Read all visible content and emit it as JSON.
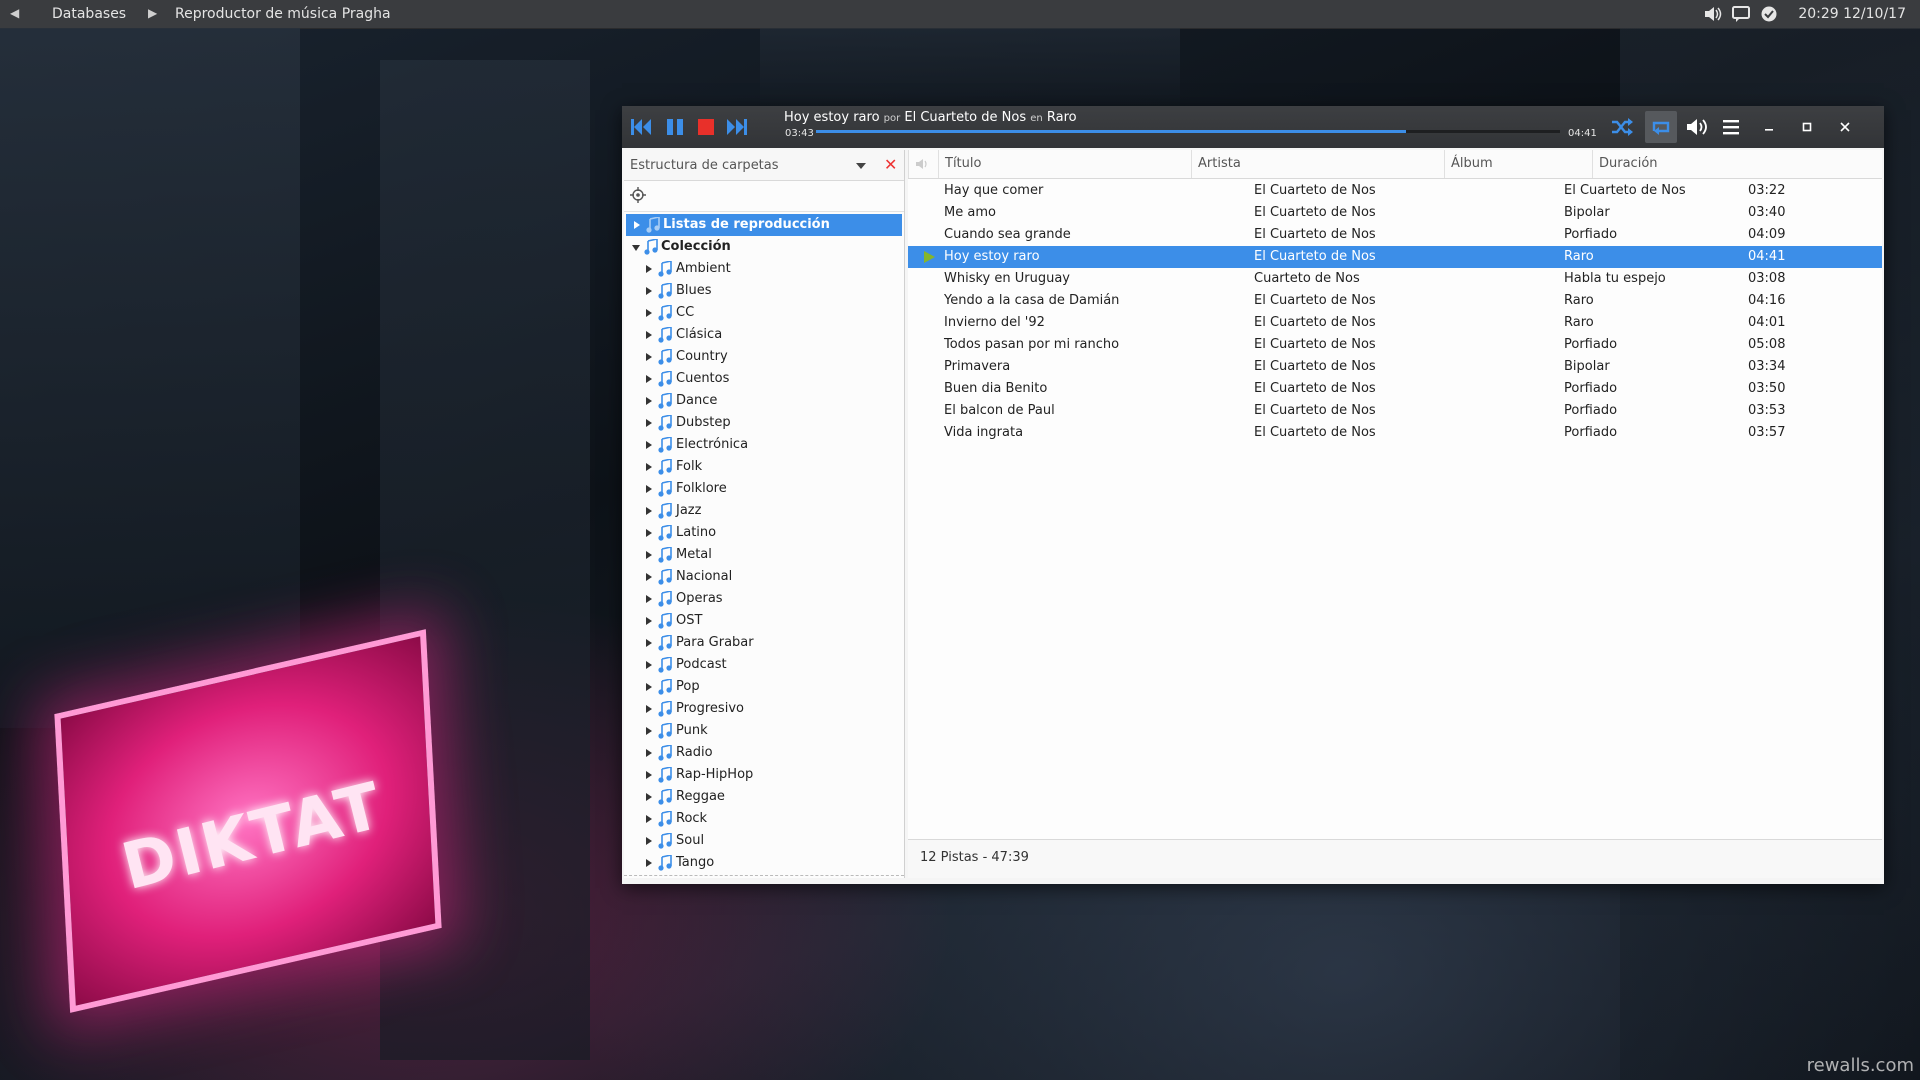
{
  "top_panel": {
    "menu_label": "Databases",
    "active_window": "Reproductor de música Pragha",
    "clock": "20:29 12/10/17"
  },
  "wallpaper": {
    "sign_text": "DIKTAT",
    "credit": "rewalls.com"
  },
  "player": {
    "now_playing": {
      "title": "Hoy estoy raro",
      "by_word": "por",
      "artist": "El Cuarteto de Nos",
      "in_word": "en",
      "album": "Raro"
    },
    "elapsed": "03:43",
    "total": "04:41",
    "progress": 0.793,
    "accent_color": "#3c8ee8",
    "controls": [
      "prev-icon",
      "pause-icon",
      "stop-icon",
      "next-icon",
      "shuffle-icon",
      "repeat-icon",
      "volume-icon",
      "menu-icon",
      "minimize-icon",
      "maximize-icon",
      "close-icon"
    ]
  },
  "sidebar": {
    "title": "Estructura de carpetas",
    "playlists_label": "Listas de reproducción",
    "collection_label": "Colección",
    "folders": [
      "Ambient",
      "Blues",
      "CC",
      "Clásica",
      "Country",
      "Cuentos",
      "Dance",
      "Dubstep",
      "Electrónica",
      "Folk",
      "Folklore",
      "Jazz",
      "Latino",
      "Metal",
      "Nacional",
      "Operas",
      "OST",
      "Para Grabar",
      "Podcast",
      "Pop",
      "Progresivo",
      "Punk",
      "Radio",
      "Rap-HipHop",
      "Reggae",
      "Rock",
      "Soul",
      "Tango"
    ]
  },
  "tracklist": {
    "columns": {
      "title": "Título",
      "artist": "Artista",
      "album": "Álbum",
      "duration": "Duración"
    },
    "playing_index": 3,
    "rows": [
      {
        "title": "Hay que comer",
        "artist": "El Cuarteto de Nos",
        "album": "El Cuarteto de Nos",
        "duration": "03:22"
      },
      {
        "title": "Me amo",
        "artist": "El Cuarteto de Nos",
        "album": "Bipolar",
        "duration": "03:40"
      },
      {
        "title": "Cuando sea grande",
        "artist": "El Cuarteto de Nos",
        "album": "Porfiado",
        "duration": "04:09"
      },
      {
        "title": "Hoy estoy raro",
        "artist": "El Cuarteto de Nos",
        "album": "Raro",
        "duration": "04:41"
      },
      {
        "title": "Whisky en Uruguay",
        "artist": "Cuarteto de Nos",
        "album": "Habla tu espejo",
        "duration": "03:08"
      },
      {
        "title": "Yendo a la casa de Damián",
        "artist": "El Cuarteto de Nos",
        "album": "Raro",
        "duration": "04:16"
      },
      {
        "title": "Invierno del '92",
        "artist": "El Cuarteto de Nos",
        "album": "Raro",
        "duration": "04:01"
      },
      {
        "title": "Todos pasan por mi rancho",
        "artist": "El Cuarteto de Nos",
        "album": "Porfiado",
        "duration": "05:08"
      },
      {
        "title": "Primavera",
        "artist": "El Cuarteto de Nos",
        "album": "Bipolar",
        "duration": "03:34"
      },
      {
        "title": "Buen dia Benito",
        "artist": "El Cuarteto de Nos",
        "album": "Porfiado",
        "duration": "03:50"
      },
      {
        "title": "El balcon de Paul",
        "artist": "El Cuarteto de Nos",
        "album": "Porfiado",
        "duration": "03:53"
      },
      {
        "title": "Vida ingrata",
        "artist": "El Cuarteto de Nos",
        "album": "Porfiado",
        "duration": "03:57"
      }
    ],
    "summary": "12 Pistas - 47:39"
  }
}
